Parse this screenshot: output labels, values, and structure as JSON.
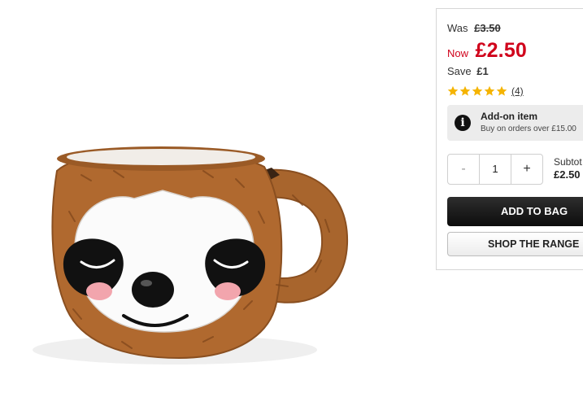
{
  "product": {
    "image_alt": "Sloth mug"
  },
  "pricing": {
    "was_label": "Was",
    "was_price": "£3.50",
    "now_label": "Now",
    "now_price": "£2.50",
    "save_label": "Save",
    "save_amount": "£1"
  },
  "rating": {
    "stars": 5,
    "max_stars": 5,
    "count": "(4)",
    "star_color": "#f5b400"
  },
  "addon": {
    "title": "Add-on item",
    "subtitle": "Buy on orders over £15.00",
    "icon": "info-icon"
  },
  "quantity": {
    "minus": "-",
    "value": "1",
    "plus": "+"
  },
  "subtotal": {
    "label": "Subtot",
    "value": "£2.50"
  },
  "actions": {
    "add_to_bag": "ADD TO BAG",
    "shop_range": "SHOP THE RANGE"
  },
  "colors": {
    "sale_red": "#d0021b",
    "button_dark": "#1a1a1a"
  }
}
